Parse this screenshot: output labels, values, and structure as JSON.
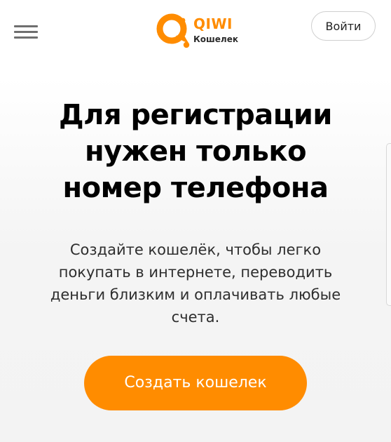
{
  "header": {
    "menu_icon": "hamburger-menu-icon",
    "logo": {
      "wordmark": "QIWI",
      "subtitle": "Кошелек",
      "mark_icon": "qiwi-logo-icon",
      "color": "#ff8c00"
    },
    "login_label": "Войти"
  },
  "main": {
    "title_lines": [
      "Для регистрации",
      "нужен только",
      "номер телефона"
    ],
    "description_lines": [
      "Создайте кошелёк, чтобы легко",
      "покупать в интернете, переводить",
      "деньги близким и оплачивать любые",
      "счета."
    ],
    "create_button_label": "Создать кошелек"
  },
  "colors": {
    "accent": "#ff8c00",
    "text": "#000000",
    "muted_text": "#2e2e2e",
    "background": "#f4f4f4"
  }
}
